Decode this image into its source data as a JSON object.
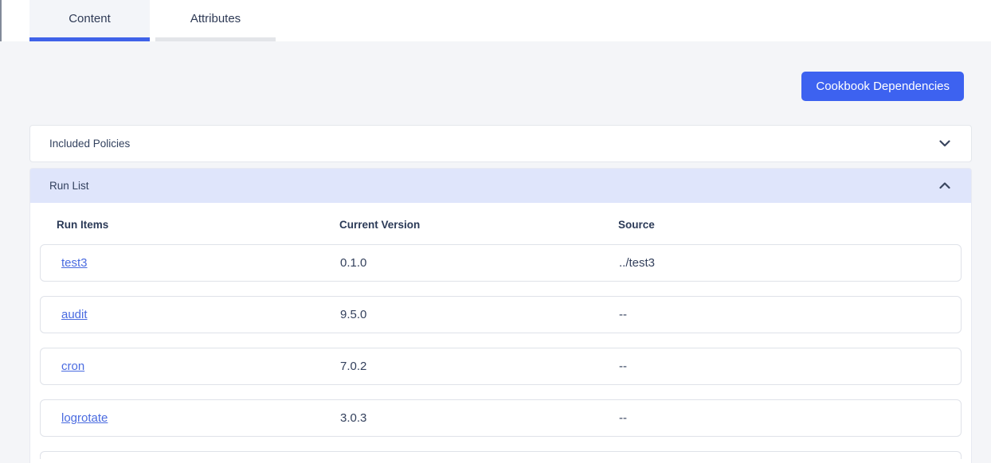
{
  "tabs": [
    {
      "label": "Content",
      "active": true
    },
    {
      "label": "Attributes",
      "active": false
    }
  ],
  "toolbar": {
    "cookbook_dependencies_label": "Cookbook Dependencies"
  },
  "panels": {
    "included_policies": {
      "title": "Included Policies",
      "state": "collapsed"
    },
    "run_list": {
      "title": "Run List",
      "state": "expanded",
      "table": {
        "columns": [
          "Run Items",
          "Current Version",
          "Source"
        ],
        "rows": [
          {
            "run_item": "test3",
            "current_version": "0.1.0",
            "source": "../test3"
          },
          {
            "run_item": "audit",
            "current_version": "9.5.0",
            "source": "--"
          },
          {
            "run_item": "cron",
            "current_version": "7.0.2",
            "source": "--"
          },
          {
            "run_item": "logrotate",
            "current_version": "3.0.3",
            "source": "--"
          }
        ]
      }
    }
  },
  "colors": {
    "accent": "#3d62f0",
    "active_tab_underline": "#3f62e9",
    "link": "#4a6be0",
    "run_list_header_bg": "#dfe5fb",
    "page_bg": "#f4f5f8"
  }
}
